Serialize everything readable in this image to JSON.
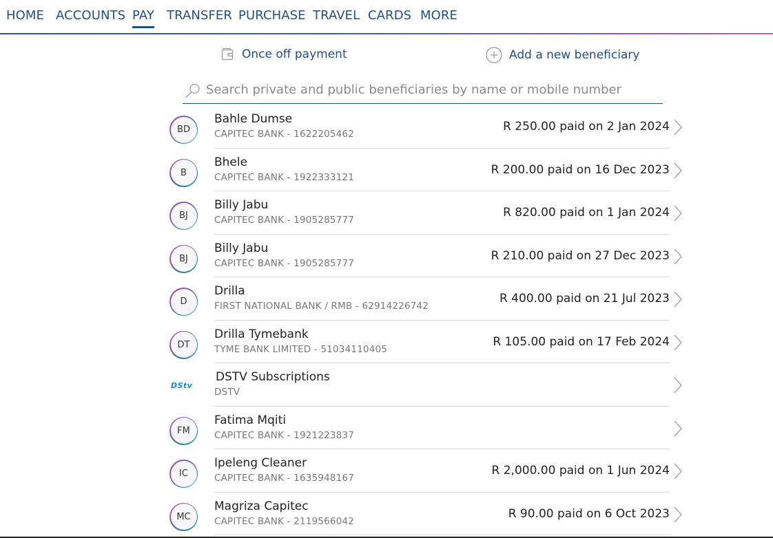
{
  "nav": {
    "items": [
      {
        "label": "HOME"
      },
      {
        "label": "ACCOUNTS"
      },
      {
        "label": "PAY",
        "active": true
      },
      {
        "label": "TRANSFER"
      },
      {
        "label": "PURCHASE"
      },
      {
        "label": "TRAVEL"
      },
      {
        "label": "CARDS"
      },
      {
        "label": "MORE"
      }
    ]
  },
  "actions": {
    "once_off": {
      "label": "Once off payment",
      "icon": "wallet-icon"
    },
    "add_beneficiary": {
      "label": "Add a new beneficiary",
      "icon": "plus-circle-icon"
    }
  },
  "search": {
    "placeholder": "Search private and public beneficiaries by name or mobile number",
    "value": "",
    "icon": "search-icon"
  },
  "beneficiaries": [
    {
      "initials": "BD",
      "name": "Bahle Dumse",
      "bank": "CAPITEC BANK - 1622205462",
      "last_payment": "R 250.00 paid on 2 Jan 2024"
    },
    {
      "initials": "B",
      "name": "Bhele",
      "bank": "CAPITEC BANK - 1922333121",
      "last_payment": "R 200.00 paid on 16 Dec 2023"
    },
    {
      "initials": "BJ",
      "name": "Billy Jabu",
      "bank": "CAPITEC BANK - 1905285777",
      "last_payment": "R 820.00 paid on 1 Jan 2024"
    },
    {
      "initials": "BJ",
      "name": "Billy Jabu",
      "bank": "CAPITEC BANK - 1905285777",
      "last_payment": "R 210.00 paid on 27 Dec 2023"
    },
    {
      "initials": "D",
      "name": "Drilla",
      "bank": "FIRST NATIONAL BANK / RMB - 62914226742",
      "last_payment": "R 400.00 paid on 21 Jul 2023"
    },
    {
      "initials": "DT",
      "name": "Drilla Tymebank",
      "bank": "TYME BANK LIMITED - 51034110405",
      "last_payment": "R 105.00 paid on 17 Feb 2024"
    },
    {
      "logo": "DStv",
      "name": "DSTV Subscriptions",
      "bank": "DSTV",
      "last_payment": ""
    },
    {
      "initials": "FM",
      "name": "Fatima Mqiti",
      "bank": "CAPITEC BANK - 1921223837",
      "last_payment": ""
    },
    {
      "initials": "IC",
      "name": "Ipeleng Cleaner",
      "bank": "CAPITEC BANK - 1635948167",
      "last_payment": "R 2,000.00 paid on 1 Jun 2024"
    },
    {
      "initials": "MC",
      "name": "Magriza Capitec",
      "bank": "CAPITEC BANK - 2119566042",
      "last_payment": "R 90.00 paid on 6 Oct 2023"
    }
  ],
  "colors": {
    "brand": "#1f4e8c",
    "text": "#222222",
    "muted": "#777777"
  }
}
